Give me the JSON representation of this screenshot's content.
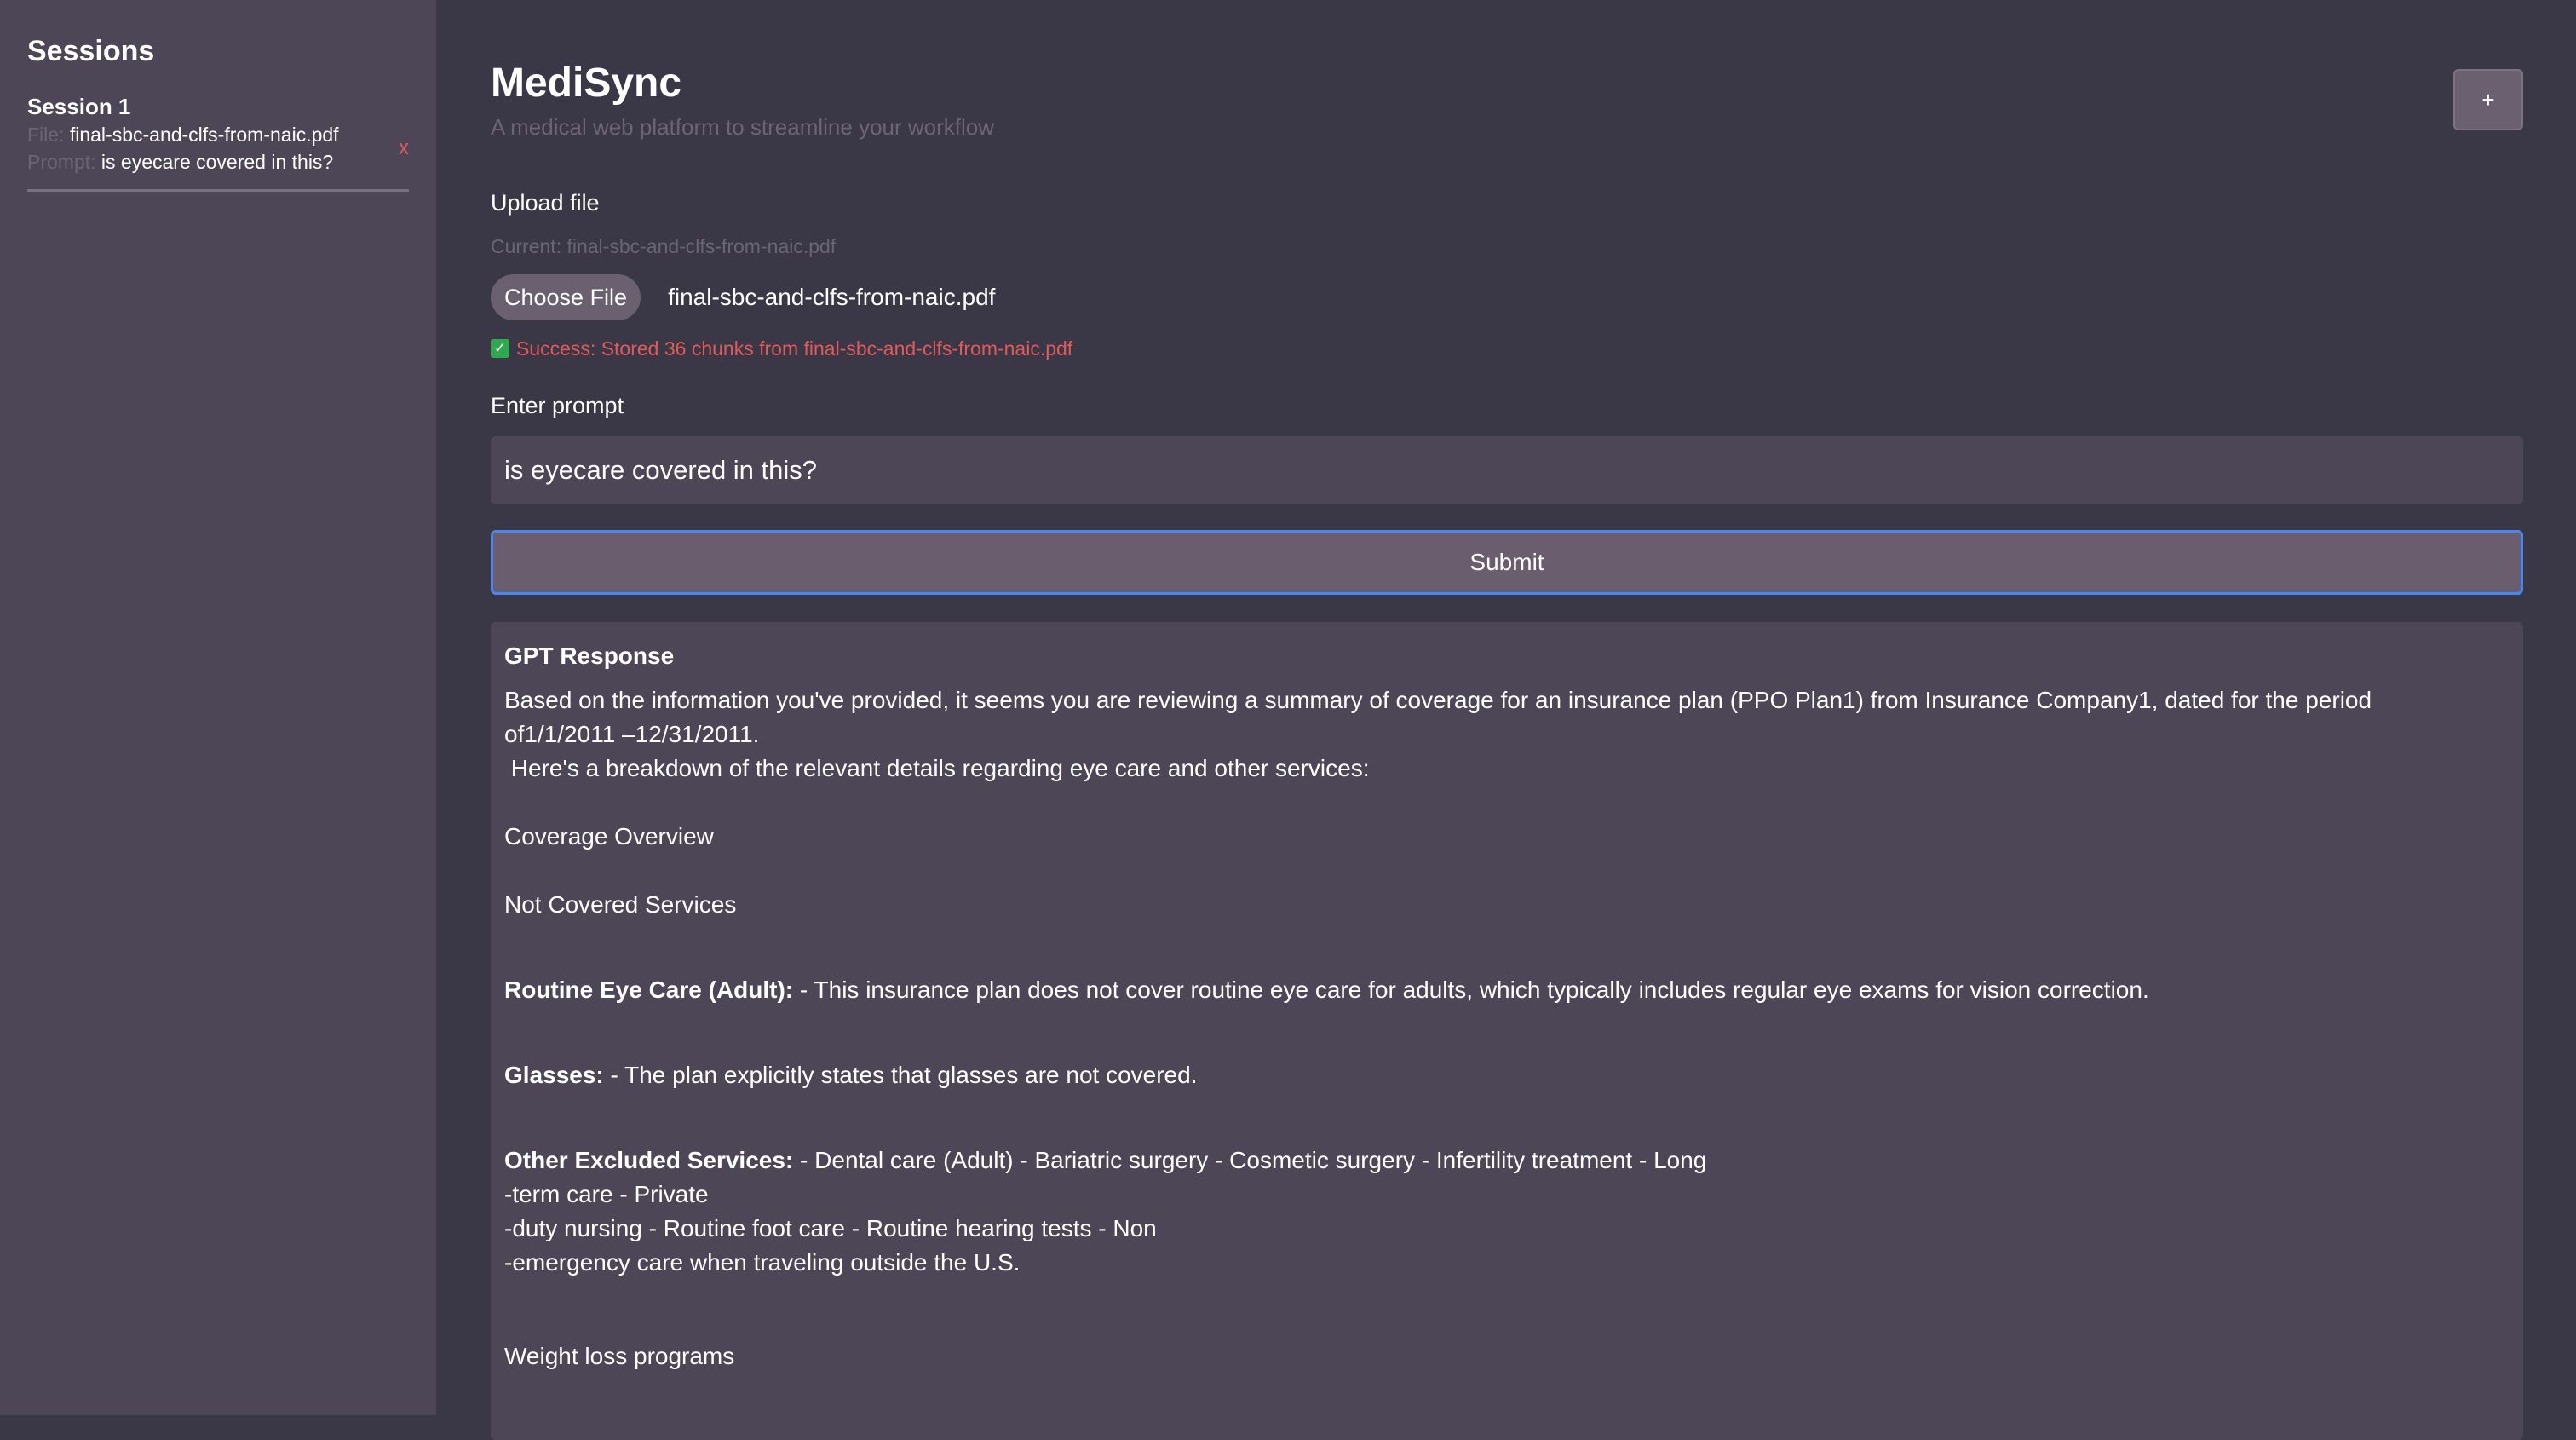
{
  "sidebar": {
    "title": "Sessions",
    "sessions": [
      {
        "title": "Session 1",
        "file_label": "File:",
        "file_value": "final-sbc-and-clfs-from-naic.pdf",
        "prompt_label": "Prompt:",
        "prompt_value": "is eyecare covered in this?",
        "close_label": "x"
      }
    ]
  },
  "header": {
    "title": "MediSync",
    "subtitle": "A medical web platform to streamline your workflow",
    "add_label": "+"
  },
  "upload": {
    "label": "Upload file",
    "current": "Current: final-sbc-and-clfs-from-naic.pdf",
    "choose_label": "Choose File",
    "chosen_name": "final-sbc-and-clfs-from-naic.pdf",
    "success_icon": "✓",
    "success_text": "Success: Stored 36 chunks from final-sbc-and-clfs-from-naic.pdf"
  },
  "prompt": {
    "label": "Enter prompt",
    "value": "is eyecare covered in this?"
  },
  "submit": {
    "label": "Submit"
  },
  "response": {
    "title": "GPT Response",
    "line_1": "Based on the information you've provided, it seems you are reviewing a summary of coverage for an insurance plan (PPO Plan1) from Insurance Company1, dated for the period",
    "line_2": "of1/1/2011 –12/31/2011.",
    "line_3": " Here's a breakdown of the relevant details regarding eye care and other services:",
    "line_4": "Coverage Overview",
    "line_5": "Not Covered Services",
    "routine_bold": "Routine Eye Care (Adult):",
    "routine_text": " - This insurance plan does not cover routine eye care for adults, which typically includes regular eye exams for vision correction.",
    "glasses_bold": "Glasses:",
    "glasses_text": " - The plan explicitly states that glasses are not covered.",
    "other_bold": "Other Excluded Services:",
    "other_text": " - Dental care (Adult) - Bariatric surgery - Cosmetic surgery - Infertility treatment - Long",
    "other_line_2": "-term care - Private",
    "other_line_3": "-duty nursing - Routine foot care - Routine hearing tests - Non",
    "other_line_4": "-emergency care when traveling outside the U.S.",
    "weight_line": "Weight loss programs"
  }
}
